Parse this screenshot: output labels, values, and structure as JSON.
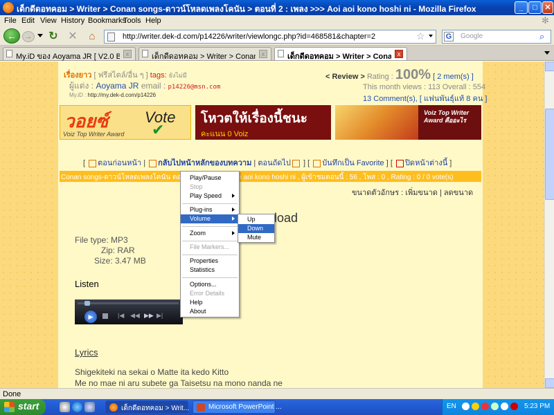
{
  "window": {
    "title": "เด็กดีดอทคอม > Writer > Conan songs-ดาวน์โหลดเพลงโคนัน > ตอนที่ 2 : เพลง >>> Aoi aoi kono hoshi ni - Mozilla Firefox",
    "minimize": "_",
    "maximize": "□",
    "close": "✕"
  },
  "menu": [
    "File",
    "Edit",
    "View",
    "History",
    "Bookmarks",
    "Tools",
    "Help"
  ],
  "nav": {
    "url": "http://writer.dek-d.com/p14226/writer/viewlongc.php?id=468581&chapter=2",
    "search_placeholder": "Google",
    "search_engine": "G"
  },
  "tabs": [
    {
      "label": "My.iD ของ Aoyama JR [ V2.0 Beta ]",
      "active": false
    },
    {
      "label": "เด็กดีดอทคอม > Writer > Conan songs...",
      "active": false
    },
    {
      "label": "เด็กดีดอทคอม > Writer > Conan s...",
      "active": true
    }
  ],
  "page": {
    "genre_label": "เรื่องยาว",
    "genre_value": "[ ฟรีสไตล์/อื่น ๆ ]",
    "tags_label": "tags:",
    "tags_value": "ยังไม่มี",
    "author_label": "ผู้แต่ง :",
    "author_name": "Aoyama JR",
    "email_label": "email :",
    "email_value": "p14226@msn.com",
    "myid_label": "My.iD :",
    "myid_value": "http://my.dek-d.com/p14226",
    "review_label": "< Review >",
    "rating_label": "Rating :",
    "rating_value": "100%",
    "rating_members": "[ 2 mem(s) ]",
    "month_views": "This month views : 113",
    "overall": "Overall : 554",
    "comments": "13 Comment(s), [ แฟนพันธุ์แท้ 8 คน ]",
    "banner": {
      "logo": "วอยซ์",
      "award": "Voiz Top Writer Award",
      "vote": "Vote",
      "headline": "โหวตให้เรื่องนี้ชนะ",
      "score": "คะแนน 0 Voiz",
      "right_text": "Voiz Top Writer Award คืออะไร"
    },
    "navlinks": {
      "prev": "ตอนก่อนหน้า",
      "back_to_main": "กลับไปหน้าหลักของบทความ",
      "next": "ตอนถัดไป",
      "favorite": "บันทึกเป็น Favorite",
      "close_window": "ปิดหน้าต่างนี้"
    },
    "stripe": "Conan songs-ดาวน์โหลดเพลงโคนัน ตอนที่ 2 : เพลง >>> aoi aoi kono hoshi ni , ผู้เข้าชมตอนนี้ : 56 , โพส : 0 , Rating : 0 / 0 vote(s)",
    "fontsize_label": "ขนาดตัวอักษร :",
    "fontsize_increase": "เพิ่มขนาด",
    "fontsize_decrease": "ลดขนาด",
    "download_heading_partial": "load",
    "file_type": "File type: MP3",
    "zip": "Zip: RAR",
    "size": "Size: 3.47 MB",
    "listen": "Listen",
    "lyrics_link": "Lyrics",
    "lyrics_line1": "Shigekiteki na sekai o Matte ita kedo Kitto",
    "lyrics_line2": "Me no mae ni aru subete ga Taisetsu na mono nanda ne"
  },
  "context_menu": [
    {
      "label": "Play/Pause",
      "disabled": false,
      "submenu": false
    },
    {
      "label": "Stop",
      "disabled": true,
      "submenu": false
    },
    {
      "label": "Play Speed",
      "disabled": false,
      "submenu": true
    },
    {
      "label": "Plug-ins",
      "disabled": false,
      "submenu": true
    },
    {
      "label": "Volume",
      "disabled": false,
      "submenu": true,
      "selected": true
    },
    {
      "label": "Zoom",
      "disabled": false,
      "submenu": true
    },
    {
      "label": "File Markers...",
      "disabled": true,
      "submenu": false
    },
    {
      "label": "Properties",
      "disabled": false,
      "submenu": false
    },
    {
      "label": "Statistics",
      "disabled": false,
      "submenu": false
    },
    {
      "label": "Options...",
      "disabled": false,
      "submenu": false
    },
    {
      "label": "Error Details",
      "disabled": true,
      "submenu": false
    },
    {
      "label": "Help",
      "disabled": false,
      "submenu": false
    },
    {
      "label": "About",
      "disabled": false,
      "submenu": false
    }
  ],
  "volume_submenu": [
    {
      "label": "Up",
      "selected": false
    },
    {
      "label": "Down",
      "selected": true
    },
    {
      "label": "Mute",
      "selected": false
    }
  ],
  "status": "Done",
  "taskbar": {
    "start": "start",
    "tasks": [
      {
        "label": "เด็กดีดอทคอม > Writ...",
        "active": true
      },
      {
        "label": "Microsoft PowerPoint ...",
        "active": false
      }
    ],
    "lang": "EN",
    "clock": "5:23 PM"
  }
}
